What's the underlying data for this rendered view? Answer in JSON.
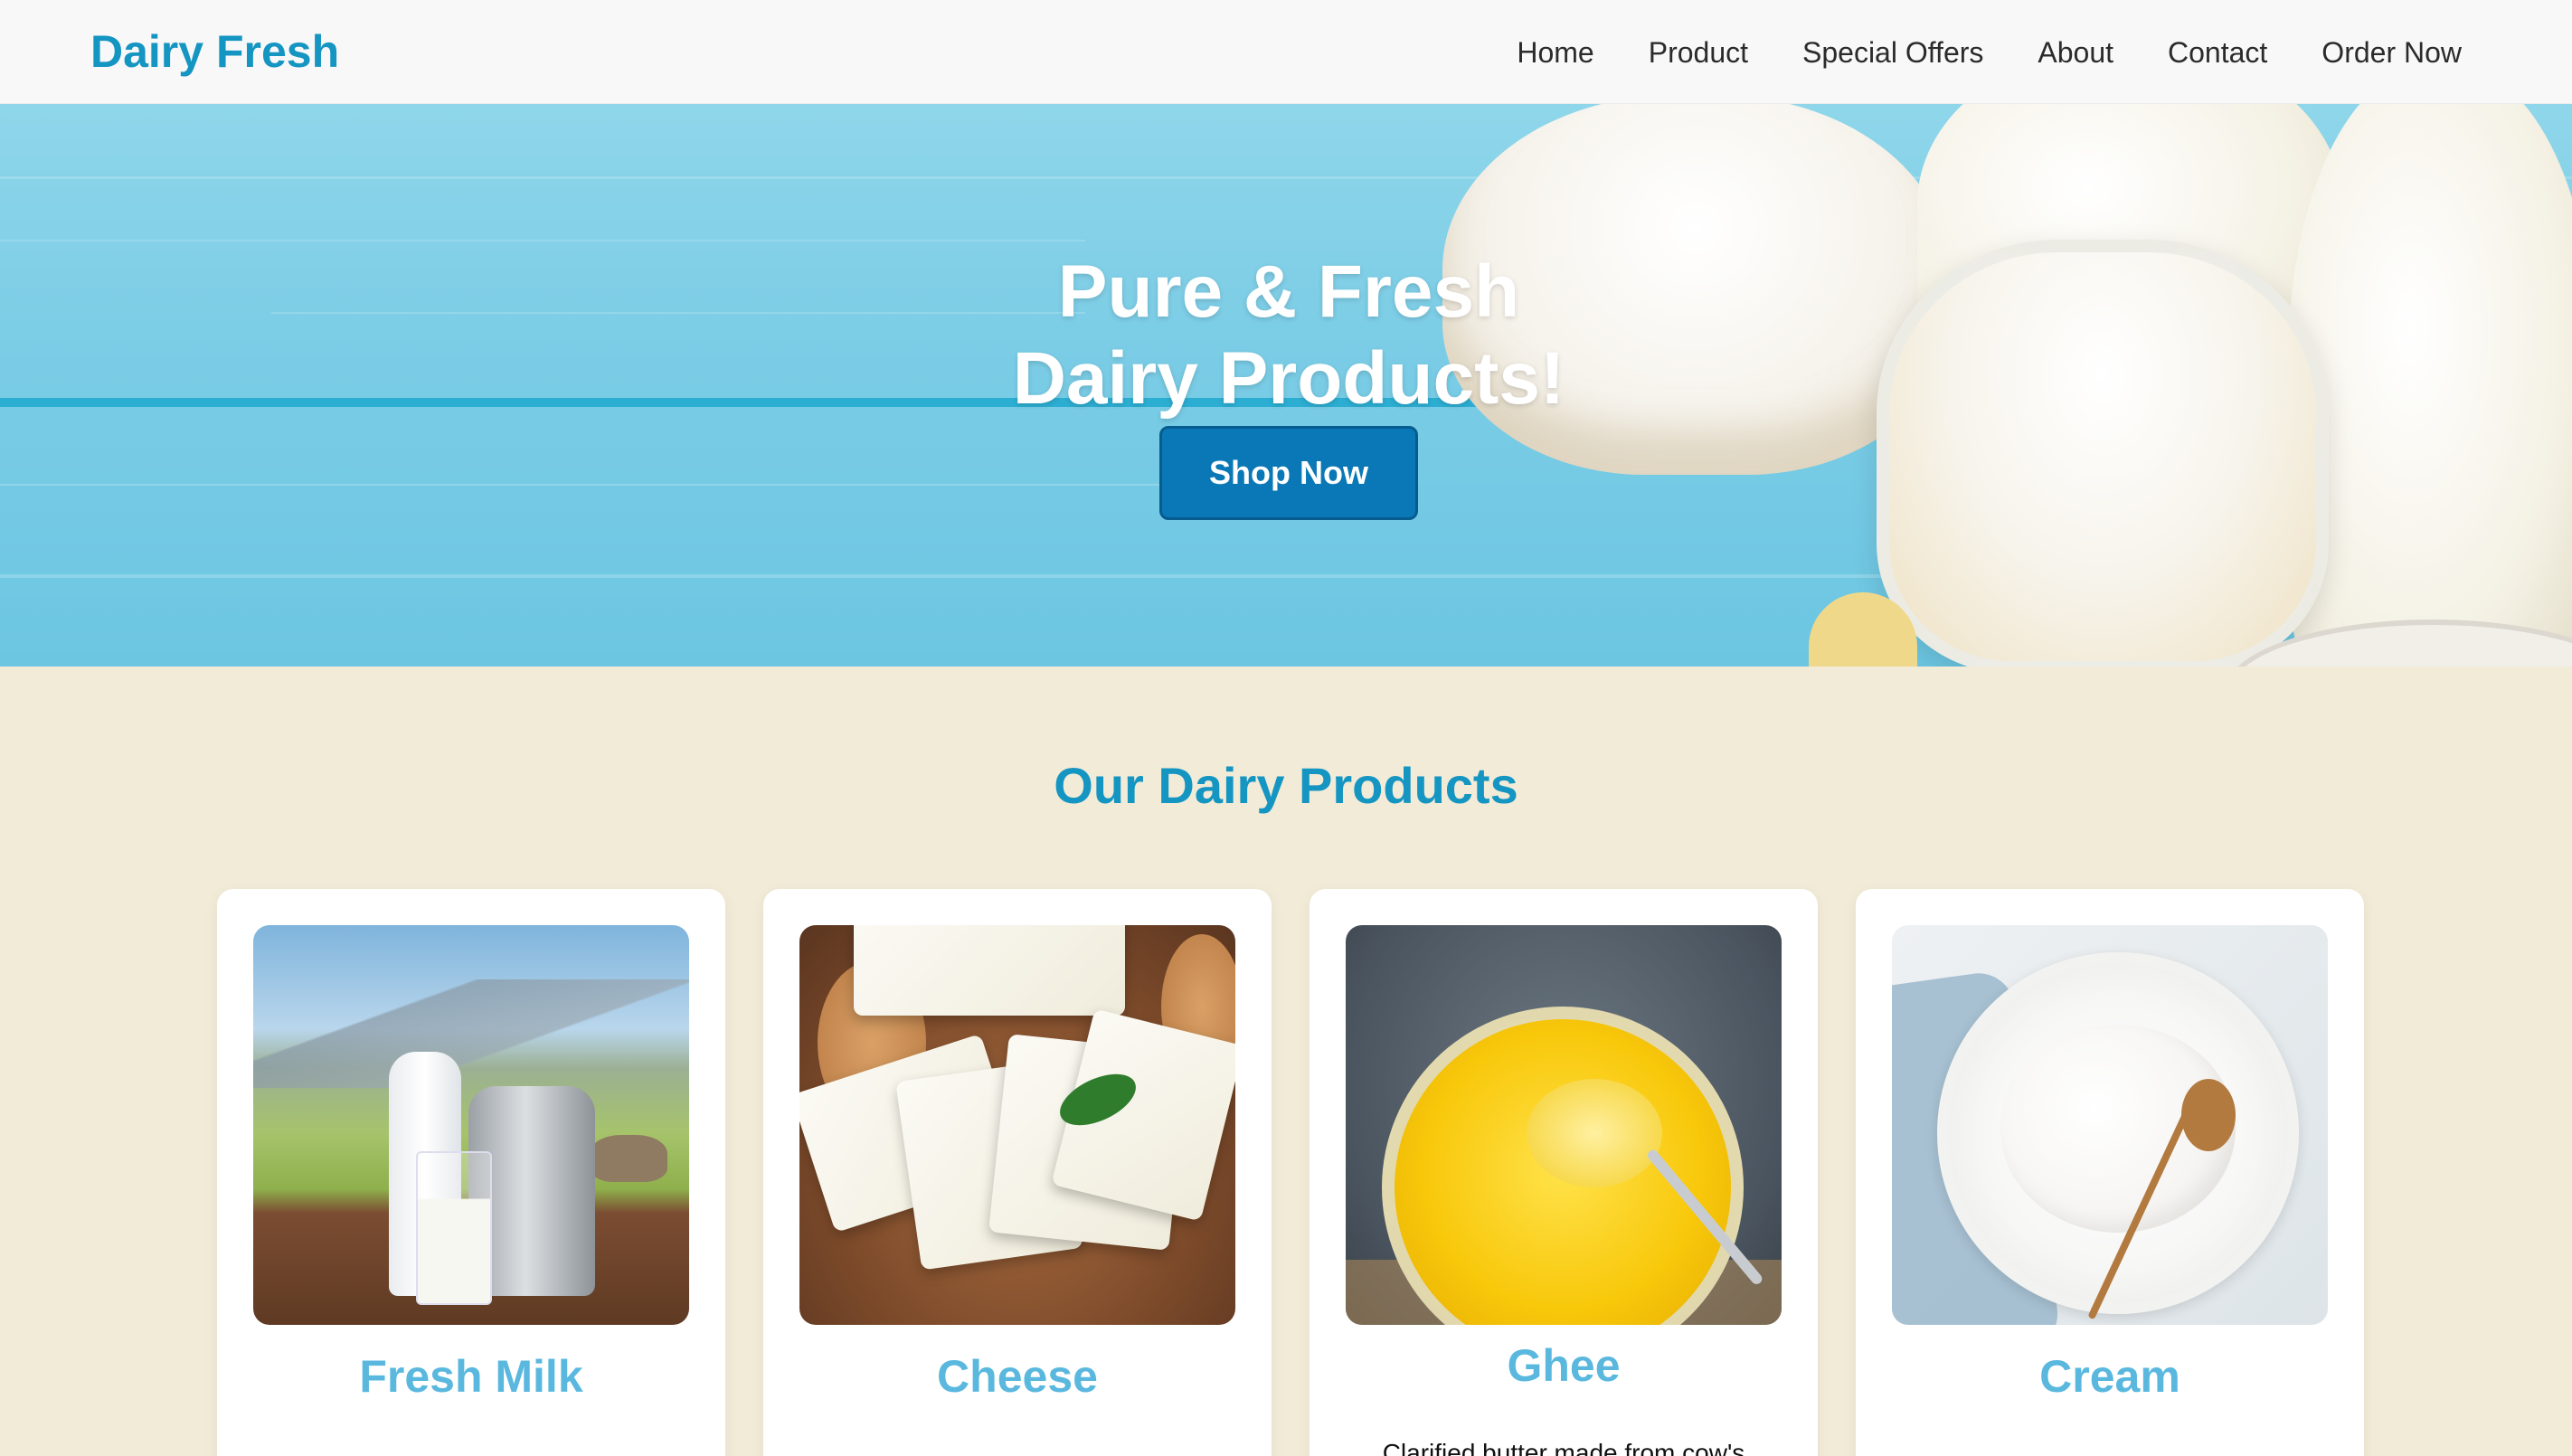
{
  "brand": {
    "name": "Dairy Fresh",
    "color": "#1595c2"
  },
  "nav": {
    "items": [
      {
        "label": "Home"
      },
      {
        "label": "Product"
      },
      {
        "label": "Special Offers"
      },
      {
        "label": "About"
      },
      {
        "label": "Contact"
      },
      {
        "label": "Order Now"
      }
    ]
  },
  "hero": {
    "title_line1": "Pure & Fresh",
    "title_line2": "Dairy Products!",
    "cta_label": "Shop Now",
    "cta_color": "#0a78b6"
  },
  "products_section": {
    "title": "Our Dairy Products",
    "items": [
      {
        "name": "Fresh Milk",
        "description": "",
        "image": "milk-bottle-and-can-image"
      },
      {
        "name": "Cheese",
        "description": "",
        "image": "sliced-cheese-image"
      },
      {
        "name": "Ghee",
        "description": "Clarified butter made from cow's",
        "image": "ghee-jar-image"
      },
      {
        "name": "Cream",
        "description": "",
        "image": "cream-bowl-image"
      }
    ]
  },
  "colors": {
    "page_background": "#f2ebd8",
    "navbar_background": "#f8f8f8",
    "card_title": "#5ab8df"
  }
}
